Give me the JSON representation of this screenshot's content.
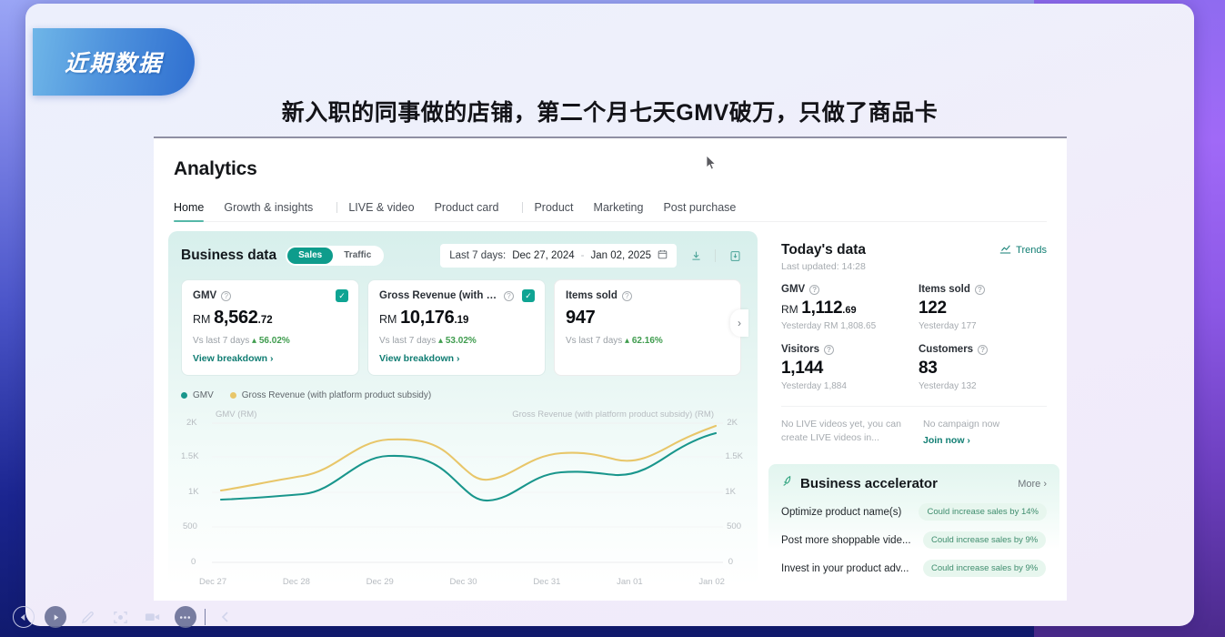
{
  "slide": {
    "badge_text": "近期数据",
    "headline": "新入职的同事做的店铺，第二个月七天GMV破万，只做了商品卡"
  },
  "app": {
    "title": "Analytics",
    "tabs": [
      {
        "label": "Home",
        "active": true
      },
      {
        "label": "Growth & insights",
        "active": false
      },
      {
        "label": "LIVE & video",
        "active": false
      },
      {
        "label": "Product card",
        "active": false
      },
      {
        "label": "Product",
        "active": false
      },
      {
        "label": "Marketing",
        "active": false
      },
      {
        "label": "Post purchase",
        "active": false
      }
    ]
  },
  "business_data": {
    "title": "Business data",
    "segments": [
      {
        "label": "Sales",
        "active": true
      },
      {
        "label": "Traffic",
        "active": false
      }
    ],
    "date_range": {
      "prefix": "Last 7 days:",
      "start": "Dec 27, 2024",
      "separator": "-",
      "end": "Jan 02, 2025",
      "calendar_icon": "calendar-icon"
    },
    "download_icon": "download-icon",
    "report_icon": "export-report-icon",
    "kpis": [
      {
        "label": "GMV",
        "currency": "RM",
        "value_main": "8,562",
        "value_decimal": ".72",
        "compare_label": "Vs last 7 days",
        "change": "56.02%",
        "change_direction": "up",
        "link": "View breakdown ›",
        "selected": true
      },
      {
        "label": "Gross Revenue (with plat...",
        "currency": "RM",
        "value_main": "10,176",
        "value_decimal": ".19",
        "compare_label": "Vs last 7 days",
        "change": "53.02%",
        "change_direction": "up",
        "link": "View breakdown ›",
        "selected": true
      },
      {
        "label": "Items sold",
        "currency": "",
        "value_main": "947",
        "value_decimal": "",
        "compare_label": "Vs last 7 days",
        "change": "62.16%",
        "change_direction": "up",
        "link": "",
        "selected": false
      }
    ],
    "next_arrow": "chevron-right-icon"
  },
  "chart_data": {
    "type": "line",
    "title": "",
    "categories": [
      "Dec 27",
      "Dec 28",
      "Dec 29",
      "Dec 30",
      "Dec 31",
      "Jan 01",
      "Jan 02"
    ],
    "series": [
      {
        "name": "GMV",
        "color": "#19968c",
        "values": [
          900,
          960,
          1500,
          950,
          1300,
          1280,
          1750
        ]
      },
      {
        "name": "Gross Revenue (with platform product subsidy)",
        "color": "#e8c669",
        "values": [
          1020,
          1150,
          1680,
          1180,
          1480,
          1430,
          1950
        ]
      }
    ],
    "left_axis_label": "GMV (RM)",
    "right_axis_label": "Gross Revenue (with platform product subsidy) (RM)",
    "yticks": [
      "2K",
      "1.5K",
      "1K",
      "500",
      "0"
    ],
    "ylim": [
      0,
      2000
    ],
    "grid": true,
    "legend_position": "top-left"
  },
  "today": {
    "title": "Today's data",
    "last_updated": "Last updated: 14:28",
    "trends_label": "Trends",
    "trends_icon": "trend-chart-icon",
    "metrics": [
      {
        "label": "GMV",
        "currency": "RM",
        "value_main": "1,112",
        "value_decimal": ".69",
        "sub": "Yesterday RM 1,808.65"
      },
      {
        "label": "Items sold",
        "currency": "",
        "value_main": "122",
        "value_decimal": "",
        "sub": "Yesterday 177"
      },
      {
        "label": "Visitors",
        "currency": "",
        "value_main": "1,144",
        "value_decimal": "",
        "sub": "Yesterday 1,884"
      },
      {
        "label": "Customers",
        "currency": "",
        "value_main": "83",
        "value_decimal": "",
        "sub": "Yesterday 132"
      }
    ],
    "notices": [
      {
        "text": "No LIVE videos yet, you can create LIVE videos in...",
        "link": ""
      },
      {
        "text": "No campaign now",
        "link": "Join now ›"
      }
    ]
  },
  "accelerator": {
    "icon": "rocket-icon",
    "title": "Business accelerator",
    "more_label": "More  ›",
    "items": [
      {
        "name": "Optimize product name(s)",
        "tag": "Could increase sales by 14%"
      },
      {
        "name": "Post more shoppable vide...",
        "tag": "Could increase sales by 9%"
      },
      {
        "name": "Invest in your product adv...",
        "tag": "Could increase sales by 9%"
      }
    ]
  },
  "player": {
    "buttons": [
      {
        "name": "back-button",
        "icon": "◁"
      },
      {
        "name": "play-button",
        "icon": "▶"
      },
      {
        "name": "pen-button",
        "icon": "✎"
      },
      {
        "name": "screenshot-button",
        "icon": "⛶"
      },
      {
        "name": "record-button",
        "icon": "▭"
      },
      {
        "name": "more-button",
        "icon": "•••"
      },
      {
        "name": "collapse-button",
        "icon": "‹"
      }
    ]
  },
  "colors": {
    "accent_teal": "#0e9c8c",
    "series_gmv": "#19968c",
    "series_revenue": "#e8c669",
    "up_green": "#3f9c4e",
    "badge_blue": "#2f6fd0"
  }
}
